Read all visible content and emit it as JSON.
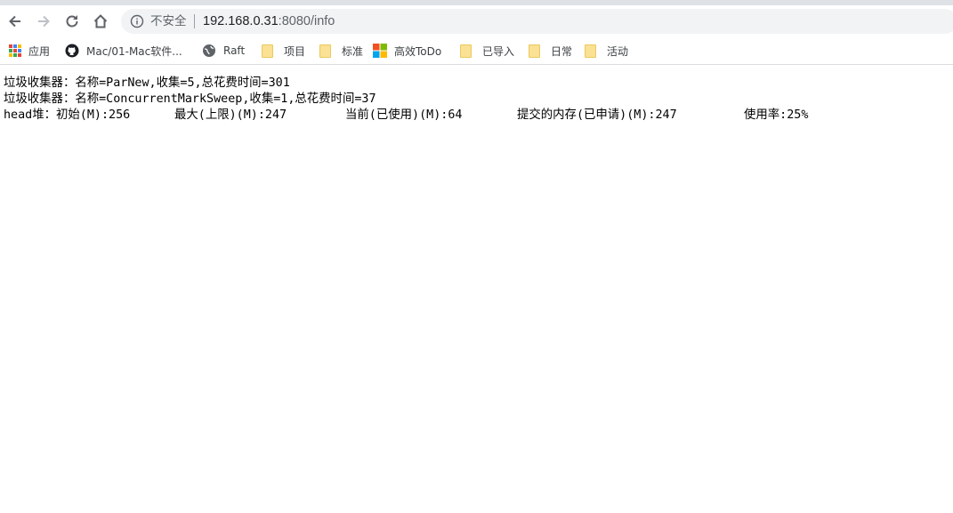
{
  "toolbar": {
    "back_icon": "arrow-left-icon",
    "forward_icon": "arrow-right-icon",
    "reload_icon": "reload-icon",
    "home_icon": "home-icon"
  },
  "omnibox": {
    "security_text": "不安全",
    "url_host": "192.168.0.31",
    "url_path": ":8080/info"
  },
  "bookmarks": [
    {
      "label": "应用",
      "icon": "apps-grid-icon"
    },
    {
      "label": "Mac/01-Mac软件...",
      "icon": "github-icon"
    },
    {
      "label": "Raft",
      "icon": "globe-icon"
    },
    {
      "label": "项目",
      "icon": "folder-icon"
    },
    {
      "label": "标准",
      "icon": "folder-icon"
    },
    {
      "label": "高效ToDo",
      "icon": "microsoft-icon"
    },
    {
      "label": "已导入",
      "icon": "folder-icon"
    },
    {
      "label": "日常",
      "icon": "folder-icon"
    },
    {
      "label": "活动",
      "icon": "folder-icon"
    }
  ],
  "page": {
    "gc_lines": [
      "垃圾收集器：名称=ParNew,收集=5,总花费时间=301",
      "垃圾收集器：名称=ConcurrentMarkSweep,收集=1,总花费时间=37"
    ],
    "heap": {
      "init": "head堆：初始(M):256",
      "max": "最大(上限)(M):247",
      "used": "当前(已使用)(M):64",
      "committed": "提交的内存(已申请)(M):247",
      "usage": "使用率:25%"
    }
  }
}
